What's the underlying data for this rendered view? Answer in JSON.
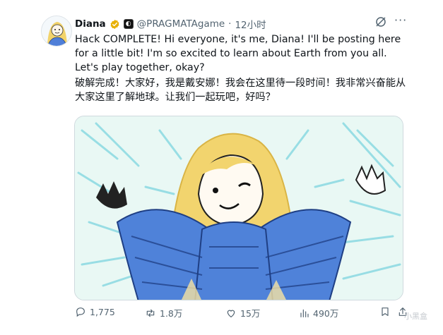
{
  "tweet": {
    "display_name": "Diana",
    "handle": "@PRAGMATAgame",
    "separator": "·",
    "time": "12小时",
    "affiliate_badge": "◐",
    "text_en": "Hack COMPLETE! Hi everyone, it's me, Diana! I'll be posting here for a little bit! I'm so excited to learn about Earth from you all. Let's play together, okay?",
    "text_zh": "破解完成！大家好，我是戴安娜！我会在这里待一段时间！我非常兴奋能从大家这里了解地球。让我们一起玩吧，好吗？",
    "more_icon": "more-dots-icon",
    "grok_icon": "grok-icon"
  },
  "actions": {
    "replies": "1,775",
    "retweets": "1.8万",
    "likes": "15万",
    "views": "490万"
  },
  "watermark": "小黑盒",
  "colors": {
    "text": "#0f1419",
    "muted": "#536471",
    "verified": "#e8b000",
    "border": "#cfd9de"
  }
}
